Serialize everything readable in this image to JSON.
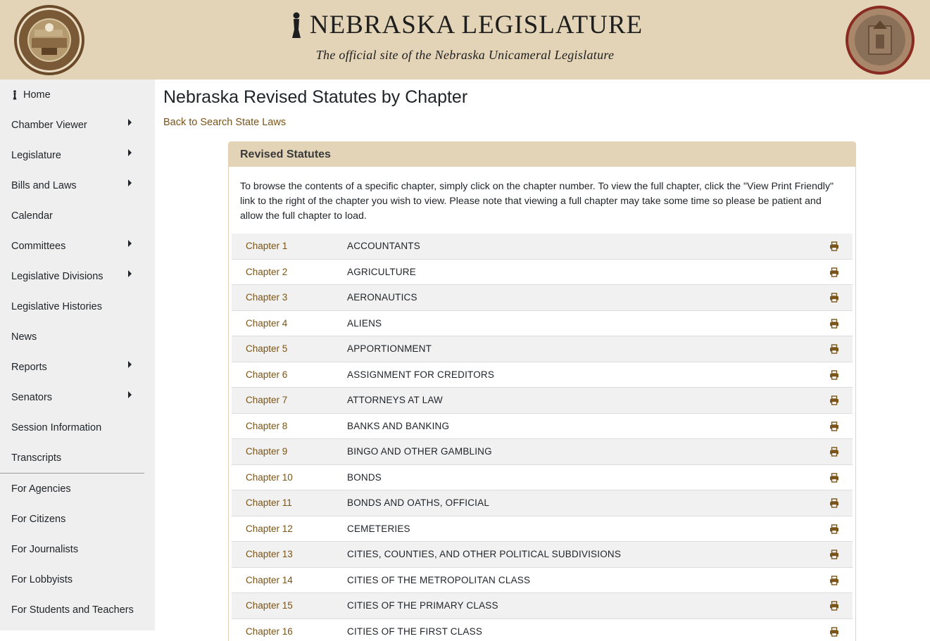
{
  "header": {
    "title": "NEBRASKA LEGISLATURE",
    "subtitle": "The official site of the Nebraska Unicameral Legislature",
    "left_seal_icon": "great-seal-of-nebraska-icon",
    "right_seal_icon": "legislature-seal-icon",
    "title_icon": "sower-icon"
  },
  "colors": {
    "header_bg": "#e3d4b8",
    "sidebar_bg": "#efefef",
    "link": "#7a5418",
    "row_alt": "#f1f1f1"
  },
  "sidebar": {
    "items": [
      {
        "label": "Home",
        "has_submenu": false,
        "icon": "sower-icon"
      },
      {
        "label": "Chamber Viewer",
        "has_submenu": true
      },
      {
        "label": "Legislature",
        "has_submenu": true
      },
      {
        "label": "Bills and Laws",
        "has_submenu": true
      },
      {
        "label": "Calendar",
        "has_submenu": false
      },
      {
        "label": "Committees",
        "has_submenu": true
      },
      {
        "label": "Legislative Divisions",
        "has_submenu": true
      },
      {
        "label": "Legislative Histories",
        "has_submenu": false
      },
      {
        "label": "News",
        "has_submenu": false
      },
      {
        "label": "Reports",
        "has_submenu": true
      },
      {
        "label": "Senators",
        "has_submenu": true
      },
      {
        "label": "Session Information",
        "has_submenu": false
      },
      {
        "label": "Transcripts",
        "has_submenu": false
      }
    ],
    "audience_items": [
      {
        "label": "For Agencies"
      },
      {
        "label": "For Citizens"
      },
      {
        "label": "For Journalists"
      },
      {
        "label": "For Lobbyists"
      },
      {
        "label": "For Students and Teachers"
      }
    ]
  },
  "main": {
    "title": "Nebraska Revised Statutes by Chapter",
    "back_link": "Back to Search State Laws",
    "card": {
      "header": "Revised Statutes",
      "description": "To browse the contents of a specific chapter, simply click on the chapter number. To view the full chapter, click the \"View Print Friendly\" link to the right of the chapter you wish to view. Please note that viewing a full chapter may take some time so please be patient and allow the full chapter to load.",
      "print_icon": "printer-icon",
      "chapters": [
        {
          "chapter": "Chapter 1",
          "name": "ACCOUNTANTS"
        },
        {
          "chapter": "Chapter 2",
          "name": "AGRICULTURE"
        },
        {
          "chapter": "Chapter 3",
          "name": "AERONAUTICS"
        },
        {
          "chapter": "Chapter 4",
          "name": "ALIENS"
        },
        {
          "chapter": "Chapter 5",
          "name": "APPORTIONMENT"
        },
        {
          "chapter": "Chapter 6",
          "name": "ASSIGNMENT FOR CREDITORS"
        },
        {
          "chapter": "Chapter 7",
          "name": "ATTORNEYS AT LAW"
        },
        {
          "chapter": "Chapter 8",
          "name": "BANKS AND BANKING"
        },
        {
          "chapter": "Chapter 9",
          "name": "BINGO AND OTHER GAMBLING"
        },
        {
          "chapter": "Chapter 10",
          "name": "BONDS"
        },
        {
          "chapter": "Chapter 11",
          "name": "BONDS AND OATHS, OFFICIAL"
        },
        {
          "chapter": "Chapter 12",
          "name": "CEMETERIES"
        },
        {
          "chapter": "Chapter 13",
          "name": "CITIES, COUNTIES, AND OTHER POLITICAL SUBDIVISIONS"
        },
        {
          "chapter": "Chapter 14",
          "name": "CITIES OF THE METROPOLITAN CLASS"
        },
        {
          "chapter": "Chapter 15",
          "name": "CITIES OF THE PRIMARY CLASS"
        },
        {
          "chapter": "Chapter 16",
          "name": "CITIES OF THE FIRST CLASS"
        }
      ]
    }
  }
}
